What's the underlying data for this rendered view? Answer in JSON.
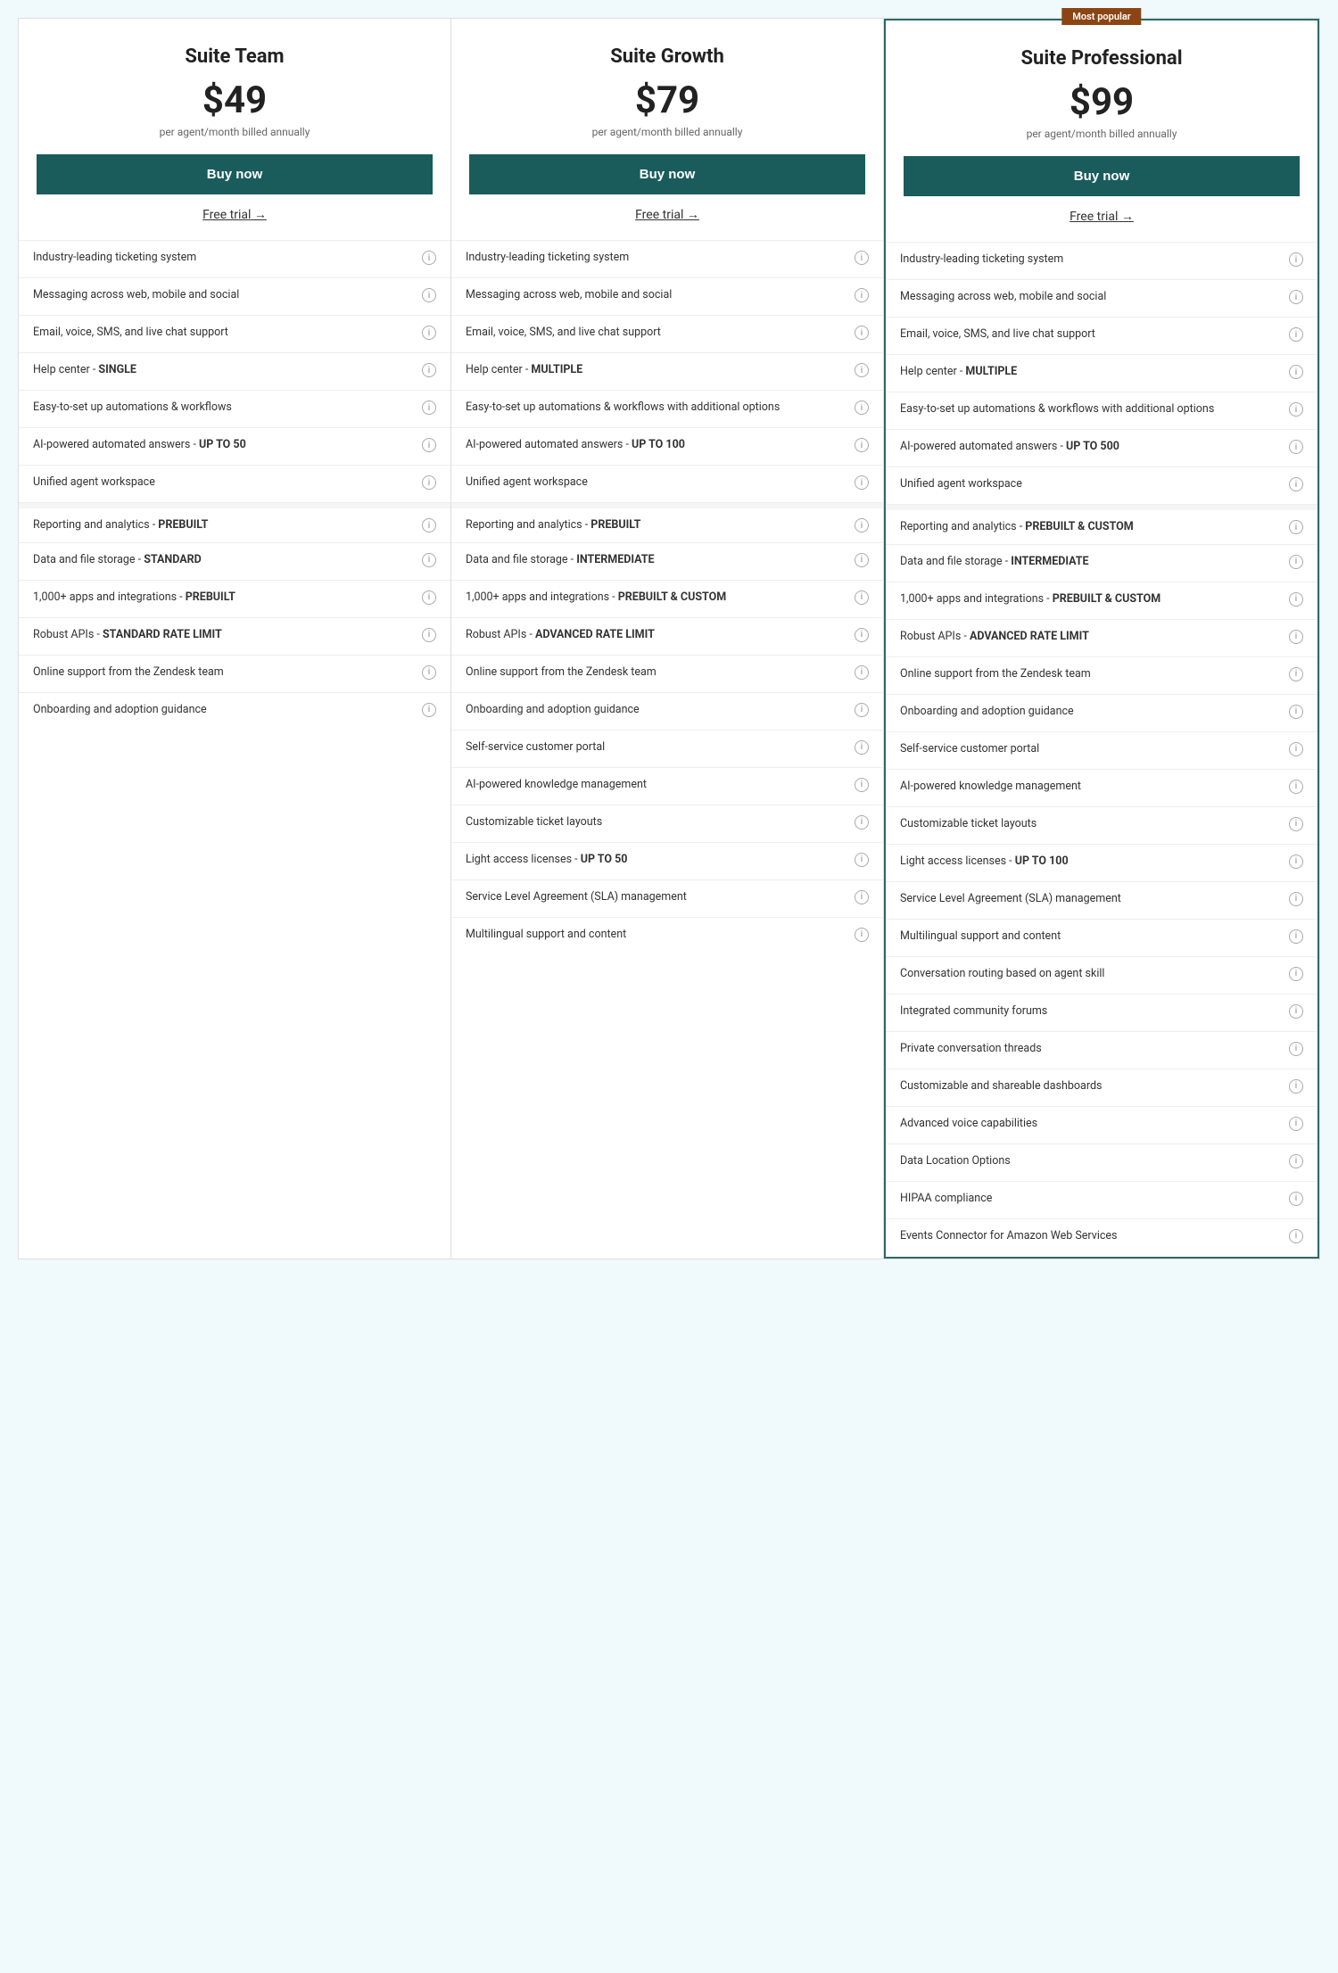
{
  "plans": [
    {
      "id": "team",
      "name": "Suite Team",
      "price": "$49",
      "billing": "per agent/month billed annually",
      "buy_label": "Buy now",
      "free_trial_label": "Free trial",
      "most_popular": false,
      "features": [
        {
          "text": "Industry-leading ticketing system",
          "bold_part": ""
        },
        {
          "text": "Messaging across web, mobile and social",
          "bold_part": ""
        },
        {
          "text": "Email, voice, SMS, and live chat support",
          "bold_part": ""
        },
        {
          "text": "Help center - <b>SINGLE</b>",
          "bold_part": "SINGLE"
        },
        {
          "text": "Easy-to-set up automations & workflows",
          "bold_part": ""
        },
        {
          "text": "AI-powered automated answers - <b>UP TO 50</b>",
          "bold_part": "UP TO 50"
        },
        {
          "text": "Unified agent workspace",
          "bold_part": ""
        },
        {
          "text": "Reporting and analytics - <b>PREBUILT</b>",
          "bold_part": "PREBUILT",
          "divider_after": true
        },
        {
          "text": "Data and file storage - <b>STANDARD</b>",
          "bold_part": "STANDARD"
        },
        {
          "text": "1,000+ apps and integrations - <b>PREBUILT</b>",
          "bold_part": "PREBUILT"
        },
        {
          "text": "Robust APIs - <b>STANDARD RATE LIMIT</b>",
          "bold_part": "STANDARD RATE LIMIT"
        },
        {
          "text": "Online support from the Zendesk team",
          "bold_part": ""
        },
        {
          "text": "Onboarding and adoption guidance",
          "bold_part": ""
        }
      ]
    },
    {
      "id": "growth",
      "name": "Suite Growth",
      "price": "$79",
      "billing": "per agent/month billed annually",
      "buy_label": "Buy now",
      "free_trial_label": "Free trial",
      "most_popular": false,
      "features": [
        {
          "text": "Industry-leading ticketing system",
          "bold_part": ""
        },
        {
          "text": "Messaging across web, mobile and social",
          "bold_part": ""
        },
        {
          "text": "Email, voice, SMS, and live chat support",
          "bold_part": ""
        },
        {
          "text": "Help center - <b>MULTIPLE</b>",
          "bold_part": "MULTIPLE"
        },
        {
          "text": "Easy-to-set up automations & workflows with additional options",
          "bold_part": ""
        },
        {
          "text": "AI-powered automated answers - <b>UP TO 100</b>",
          "bold_part": "UP TO 100"
        },
        {
          "text": "Unified agent workspace",
          "bold_part": ""
        },
        {
          "text": "Reporting and analytics - <b>PREBUILT</b>",
          "bold_part": "PREBUILT",
          "divider_after": true
        },
        {
          "text": "Data and file storage - <b>INTERMEDIATE</b>",
          "bold_part": "INTERMEDIATE"
        },
        {
          "text": "1,000+ apps and integrations - <b>PREBUILT & CUSTOM</b>",
          "bold_part": "PREBUILT & CUSTOM"
        },
        {
          "text": "Robust APIs - <b>ADVANCED RATE LIMIT</b>",
          "bold_part": "ADVANCED RATE LIMIT"
        },
        {
          "text": "Online support from the Zendesk team",
          "bold_part": ""
        },
        {
          "text": "Onboarding and adoption guidance",
          "bold_part": ""
        },
        {
          "text": "Self-service customer portal",
          "bold_part": ""
        },
        {
          "text": "AI-powered knowledge management",
          "bold_part": ""
        },
        {
          "text": "Customizable ticket layouts",
          "bold_part": ""
        },
        {
          "text": "Light access licenses - <b>UP TO 50</b>",
          "bold_part": "UP TO 50"
        },
        {
          "text": "Service Level Agreement (SLA) management",
          "bold_part": ""
        },
        {
          "text": "Multilingual support and content",
          "bold_part": ""
        }
      ]
    },
    {
      "id": "professional",
      "name": "Suite Professional",
      "price": "$99",
      "billing": "per agent/month billed annually",
      "buy_label": "Buy now",
      "free_trial_label": "Free trial",
      "most_popular": true,
      "most_popular_label": "Most popular",
      "features": [
        {
          "text": "Industry-leading ticketing system",
          "bold_part": ""
        },
        {
          "text": "Messaging across web, mobile and social",
          "bold_part": ""
        },
        {
          "text": "Email, voice, SMS, and live chat support",
          "bold_part": ""
        },
        {
          "text": "Help center - <b>MULTIPLE</b>",
          "bold_part": "MULTIPLE"
        },
        {
          "text": "Easy-to-set up automations & workflows with additional options",
          "bold_part": ""
        },
        {
          "text": "AI-powered automated answers - <b>UP TO 500</b>",
          "bold_part": "UP TO 500"
        },
        {
          "text": "Unified agent workspace",
          "bold_part": ""
        },
        {
          "text": "Reporting and analytics - <b>PREBUILT & CUSTOM</b>",
          "bold_part": "PREBUILT & CUSTOM",
          "divider_after": true
        },
        {
          "text": "Data and file storage - <b>INTERMEDIATE</b>",
          "bold_part": "INTERMEDIATE"
        },
        {
          "text": "1,000+ apps and integrations - <b>PREBUILT & CUSTOM</b>",
          "bold_part": "PREBUILT & CUSTOM"
        },
        {
          "text": "Robust APIs - <b>ADVANCED RATE LIMIT</b>",
          "bold_part": "ADVANCED RATE LIMIT"
        },
        {
          "text": "Online support from the Zendesk team",
          "bold_part": ""
        },
        {
          "text": "Onboarding and adoption guidance",
          "bold_part": ""
        },
        {
          "text": "Self-service customer portal",
          "bold_part": ""
        },
        {
          "text": "AI-powered knowledge management",
          "bold_part": ""
        },
        {
          "text": "Customizable ticket layouts",
          "bold_part": ""
        },
        {
          "text": "Light access licenses - <b>UP TO 100</b>",
          "bold_part": "UP TO 100"
        },
        {
          "text": "Service Level Agreement (SLA) management",
          "bold_part": ""
        },
        {
          "text": "Multilingual support and content",
          "bold_part": ""
        },
        {
          "text": "Conversation routing based on agent skill",
          "bold_part": ""
        },
        {
          "text": "Integrated community forums",
          "bold_part": ""
        },
        {
          "text": "Private conversation threads",
          "bold_part": ""
        },
        {
          "text": "Customizable and shareable dashboards",
          "bold_part": ""
        },
        {
          "text": "Advanced voice capabilities",
          "bold_part": ""
        },
        {
          "text": "Data Location Options",
          "bold_part": ""
        },
        {
          "text": "HIPAA compliance",
          "bold_part": ""
        },
        {
          "text": "Events Connector for Amazon Web Services",
          "bold_part": ""
        }
      ]
    }
  ],
  "info_icon_label": "i",
  "arrow": "→"
}
